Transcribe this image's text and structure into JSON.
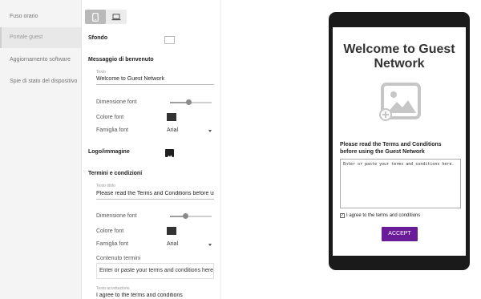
{
  "sidebar": {
    "items": [
      {
        "label": "Fuso orario"
      },
      {
        "label": "Portale guest"
      },
      {
        "label": "Aggiornamento software"
      },
      {
        "label": "Spie di stato del dispositivo"
      }
    ],
    "active_index": 1
  },
  "device_toggle": {
    "selected": "mobile-icon",
    "options": [
      "mobile-icon",
      "laptop-icon"
    ]
  },
  "settings": {
    "background": {
      "title": "Sfondo",
      "color": "#ffffff"
    },
    "welcome": {
      "title": "Messaggio di benvenuto",
      "text_label": "Testo",
      "text_value": "Welcome to Guest Network",
      "font_size_label": "Dimensione font",
      "font_size_value": 0.45,
      "font_color_label": "Colore font",
      "font_color": "#333333",
      "font_family_label": "Famiglia font",
      "font_family_value": "Arial"
    },
    "logo": {
      "title": "Logo/immagine"
    },
    "terms": {
      "title": "Termini e condizioni",
      "title_text_label": "Testo titolo",
      "title_text_value": "Please read the Terms and Conditions before using the Guest Network",
      "font_size_label": "Dimensione font",
      "font_size_value": 0.38,
      "font_color_label": "Colore font",
      "font_color": "#333333",
      "font_family_label": "Famiglia font",
      "font_family_value": "Arial",
      "content_label": "Contenuto termini",
      "content_value": "Enter or paste your terms and conditions here.",
      "accept_text_label": "Testo accettazione",
      "accept_text_value": "I agree to the terms and conditions"
    }
  },
  "preview": {
    "welcome_text": "Welcome to Guest Network",
    "terms_heading": "Please read the Terms and Conditions before using the Guest Network",
    "terms_placeholder": "Enter or paste your terms and conditions here.",
    "agree_label": "I agree to the terms and conditions",
    "agree_checked": true,
    "accept_button": "ACCEPT",
    "accent_color": "#6a1b9a"
  }
}
